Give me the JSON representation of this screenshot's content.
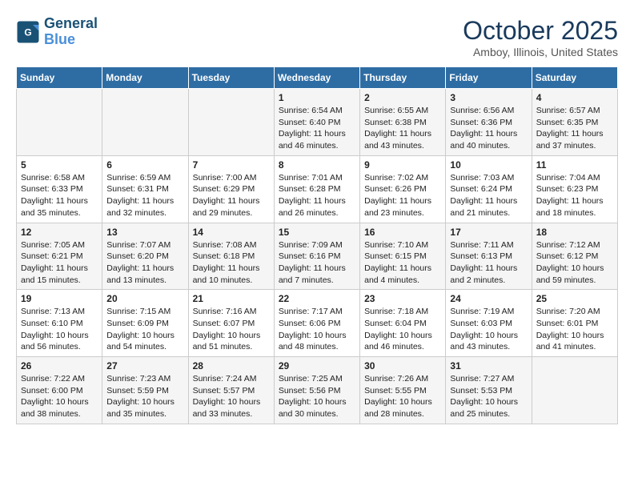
{
  "header": {
    "logo_line1": "General",
    "logo_line2": "Blue",
    "month": "October 2025",
    "location": "Amboy, Illinois, United States"
  },
  "days_of_week": [
    "Sunday",
    "Monday",
    "Tuesday",
    "Wednesday",
    "Thursday",
    "Friday",
    "Saturday"
  ],
  "weeks": [
    [
      {
        "num": "",
        "info": ""
      },
      {
        "num": "",
        "info": ""
      },
      {
        "num": "",
        "info": ""
      },
      {
        "num": "1",
        "info": "Sunrise: 6:54 AM\nSunset: 6:40 PM\nDaylight: 11 hours\nand 46 minutes."
      },
      {
        "num": "2",
        "info": "Sunrise: 6:55 AM\nSunset: 6:38 PM\nDaylight: 11 hours\nand 43 minutes."
      },
      {
        "num": "3",
        "info": "Sunrise: 6:56 AM\nSunset: 6:36 PM\nDaylight: 11 hours\nand 40 minutes."
      },
      {
        "num": "4",
        "info": "Sunrise: 6:57 AM\nSunset: 6:35 PM\nDaylight: 11 hours\nand 37 minutes."
      }
    ],
    [
      {
        "num": "5",
        "info": "Sunrise: 6:58 AM\nSunset: 6:33 PM\nDaylight: 11 hours\nand 35 minutes."
      },
      {
        "num": "6",
        "info": "Sunrise: 6:59 AM\nSunset: 6:31 PM\nDaylight: 11 hours\nand 32 minutes."
      },
      {
        "num": "7",
        "info": "Sunrise: 7:00 AM\nSunset: 6:29 PM\nDaylight: 11 hours\nand 29 minutes."
      },
      {
        "num": "8",
        "info": "Sunrise: 7:01 AM\nSunset: 6:28 PM\nDaylight: 11 hours\nand 26 minutes."
      },
      {
        "num": "9",
        "info": "Sunrise: 7:02 AM\nSunset: 6:26 PM\nDaylight: 11 hours\nand 23 minutes."
      },
      {
        "num": "10",
        "info": "Sunrise: 7:03 AM\nSunset: 6:24 PM\nDaylight: 11 hours\nand 21 minutes."
      },
      {
        "num": "11",
        "info": "Sunrise: 7:04 AM\nSunset: 6:23 PM\nDaylight: 11 hours\nand 18 minutes."
      }
    ],
    [
      {
        "num": "12",
        "info": "Sunrise: 7:05 AM\nSunset: 6:21 PM\nDaylight: 11 hours\nand 15 minutes."
      },
      {
        "num": "13",
        "info": "Sunrise: 7:07 AM\nSunset: 6:20 PM\nDaylight: 11 hours\nand 13 minutes."
      },
      {
        "num": "14",
        "info": "Sunrise: 7:08 AM\nSunset: 6:18 PM\nDaylight: 11 hours\nand 10 minutes."
      },
      {
        "num": "15",
        "info": "Sunrise: 7:09 AM\nSunset: 6:16 PM\nDaylight: 11 hours\nand 7 minutes."
      },
      {
        "num": "16",
        "info": "Sunrise: 7:10 AM\nSunset: 6:15 PM\nDaylight: 11 hours\nand 4 minutes."
      },
      {
        "num": "17",
        "info": "Sunrise: 7:11 AM\nSunset: 6:13 PM\nDaylight: 11 hours\nand 2 minutes."
      },
      {
        "num": "18",
        "info": "Sunrise: 7:12 AM\nSunset: 6:12 PM\nDaylight: 10 hours\nand 59 minutes."
      }
    ],
    [
      {
        "num": "19",
        "info": "Sunrise: 7:13 AM\nSunset: 6:10 PM\nDaylight: 10 hours\nand 56 minutes."
      },
      {
        "num": "20",
        "info": "Sunrise: 7:15 AM\nSunset: 6:09 PM\nDaylight: 10 hours\nand 54 minutes."
      },
      {
        "num": "21",
        "info": "Sunrise: 7:16 AM\nSunset: 6:07 PM\nDaylight: 10 hours\nand 51 minutes."
      },
      {
        "num": "22",
        "info": "Sunrise: 7:17 AM\nSunset: 6:06 PM\nDaylight: 10 hours\nand 48 minutes."
      },
      {
        "num": "23",
        "info": "Sunrise: 7:18 AM\nSunset: 6:04 PM\nDaylight: 10 hours\nand 46 minutes."
      },
      {
        "num": "24",
        "info": "Sunrise: 7:19 AM\nSunset: 6:03 PM\nDaylight: 10 hours\nand 43 minutes."
      },
      {
        "num": "25",
        "info": "Sunrise: 7:20 AM\nSunset: 6:01 PM\nDaylight: 10 hours\nand 41 minutes."
      }
    ],
    [
      {
        "num": "26",
        "info": "Sunrise: 7:22 AM\nSunset: 6:00 PM\nDaylight: 10 hours\nand 38 minutes."
      },
      {
        "num": "27",
        "info": "Sunrise: 7:23 AM\nSunset: 5:59 PM\nDaylight: 10 hours\nand 35 minutes."
      },
      {
        "num": "28",
        "info": "Sunrise: 7:24 AM\nSunset: 5:57 PM\nDaylight: 10 hours\nand 33 minutes."
      },
      {
        "num": "29",
        "info": "Sunrise: 7:25 AM\nSunset: 5:56 PM\nDaylight: 10 hours\nand 30 minutes."
      },
      {
        "num": "30",
        "info": "Sunrise: 7:26 AM\nSunset: 5:55 PM\nDaylight: 10 hours\nand 28 minutes."
      },
      {
        "num": "31",
        "info": "Sunrise: 7:27 AM\nSunset: 5:53 PM\nDaylight: 10 hours\nand 25 minutes."
      },
      {
        "num": "",
        "info": ""
      }
    ]
  ]
}
